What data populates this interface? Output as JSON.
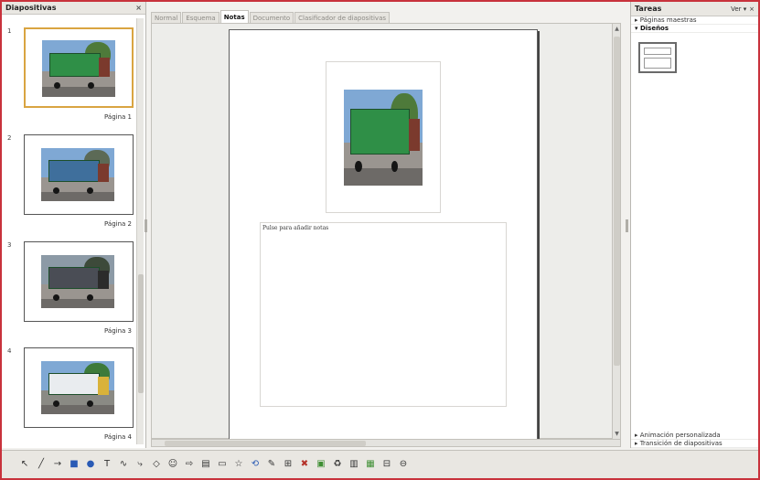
{
  "slides_pane": {
    "title": "Diapositivas",
    "close": "×",
    "slides": [
      {
        "number": "1",
        "caption": "Página 1",
        "selected": true
      },
      {
        "number": "2",
        "caption": "Página 2",
        "selected": false
      },
      {
        "number": "3",
        "caption": "Página 3",
        "selected": false
      },
      {
        "number": "4",
        "caption": "Página 4",
        "selected": false
      }
    ]
  },
  "tabs": [
    {
      "label": "Normal",
      "active": false
    },
    {
      "label": "Esquema",
      "active": false
    },
    {
      "label": "Notas",
      "active": true
    },
    {
      "label": "Documento",
      "active": false
    },
    {
      "label": "Clasificador de diapositivas",
      "active": false
    }
  ],
  "notes": {
    "placeholder": "Pulse para añadir notas"
  },
  "tasks_pane": {
    "title": "Tareas",
    "view_menu": "Ver ▾",
    "close": "×",
    "sections_top": [
      {
        "label": "▸ Páginas maestras",
        "bold": false
      },
      {
        "label": "▾ Diseños",
        "bold": true
      }
    ],
    "sections_bottom": [
      {
        "label": "▸ Animación personalizada"
      },
      {
        "label": "▸ Transición de diapositivas"
      }
    ]
  },
  "toolbar": {
    "tools": [
      {
        "glyph": "↖",
        "name": "select-tool-icon",
        "color": "default"
      },
      {
        "glyph": "╱",
        "name": "line-tool-icon",
        "color": "default"
      },
      {
        "glyph": "→",
        "name": "arrow-tool-icon",
        "color": "default"
      },
      {
        "glyph": "■",
        "name": "rectangle-tool-icon",
        "color": "blue"
      },
      {
        "glyph": "●",
        "name": "ellipse-tool-icon",
        "color": "blue"
      },
      {
        "glyph": "T",
        "name": "text-tool-icon",
        "color": "default"
      },
      {
        "glyph": "∿",
        "name": "curve-tool-icon",
        "color": "default"
      },
      {
        "glyph": "⤷",
        "name": "connector-tool-icon",
        "color": "default"
      },
      {
        "glyph": "◇",
        "name": "basic-shapes-icon",
        "color": "default"
      },
      {
        "glyph": "☺",
        "name": "symbol-shapes-icon",
        "color": "default"
      },
      {
        "glyph": "⇨",
        "name": "block-arrows-icon",
        "color": "default"
      },
      {
        "glyph": "▤",
        "name": "flowchart-icon",
        "color": "default"
      },
      {
        "glyph": "▭",
        "name": "callouts-icon",
        "color": "default"
      },
      {
        "glyph": "☆",
        "name": "stars-icon",
        "color": "default"
      },
      {
        "glyph": "⟲",
        "name": "rotate-icon",
        "color": "blue"
      },
      {
        "glyph": "✎",
        "name": "points-icon",
        "color": "default"
      },
      {
        "glyph": "⊞",
        "name": "glue-points-icon",
        "color": "default"
      },
      {
        "glyph": "✖",
        "name": "fontwork-icon",
        "color": "red"
      },
      {
        "glyph": "▣",
        "name": "from-file-icon",
        "color": "green"
      },
      {
        "glyph": "♻",
        "name": "extrusion-icon",
        "color": "default"
      },
      {
        "glyph": "▥",
        "name": "align-icon",
        "color": "default"
      },
      {
        "glyph": "▦",
        "name": "arrange-icon",
        "color": "green"
      },
      {
        "glyph": "⊟",
        "name": "shadow-icon",
        "color": "default"
      },
      {
        "glyph": "⊖",
        "name": "toggle-extrusion-icon",
        "color": "default"
      }
    ]
  },
  "colors": {
    "frame_border": "#c8323c",
    "selected_slide_border": "#d9a441",
    "truck_green": "#2f8f47"
  }
}
